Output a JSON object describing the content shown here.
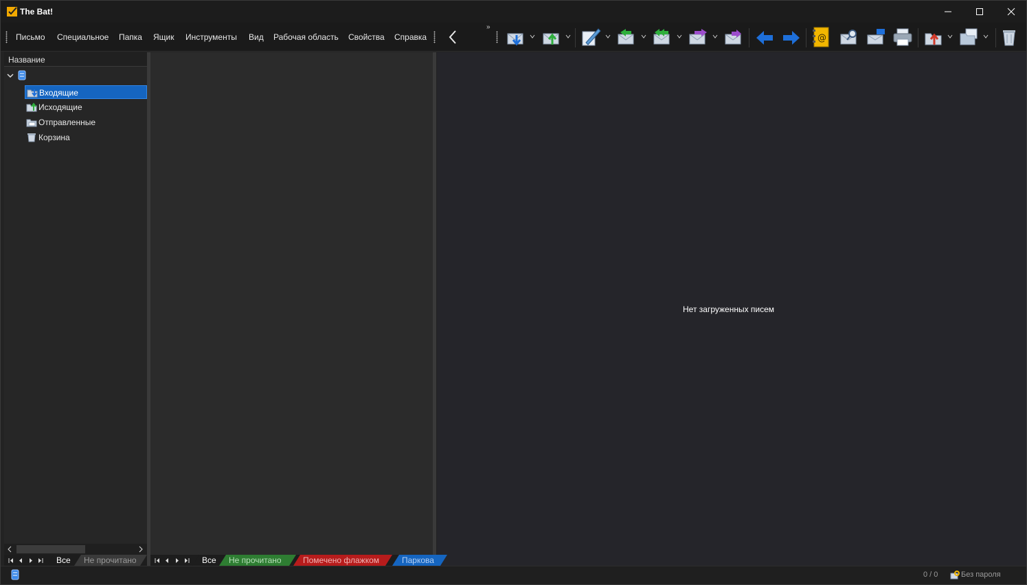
{
  "window": {
    "title": "The Bat!",
    "controls": [
      "minimize-icon",
      "maximize-icon",
      "close-icon"
    ]
  },
  "menu": {
    "items": [
      "Письмо",
      "Специальное",
      "Папка",
      "Ящик",
      "Инструменты",
      "Вид",
      "Рабочая область",
      "Свойства",
      "Справка"
    ]
  },
  "toolbar": {
    "buttons": [
      "get-mail-icon",
      "send-mail-icon",
      "new-message-icon",
      "reply-icon",
      "reply-all-icon",
      "forward-icon",
      "redirect-icon",
      "previous-icon",
      "next-icon",
      "address-book-icon",
      "find-icon",
      "mailbox-icon",
      "print-icon",
      "move-to-folder-icon",
      "copy-to-folder-icon",
      "delete-icon"
    ]
  },
  "folders": {
    "column_header": "Название",
    "account_name": "",
    "items": [
      {
        "label": "Входящие",
        "icon": "inbox-icon",
        "selected": true
      },
      {
        "label": "Исходящие",
        "icon": "outbox-icon",
        "selected": false
      },
      {
        "label": "Отправленные",
        "icon": "sent-icon",
        "selected": false
      },
      {
        "label": "Корзина",
        "icon": "trash-icon",
        "selected": false
      }
    ]
  },
  "folder_tabs": [
    "Все",
    "Не прочитано"
  ],
  "message_tabs": [
    "Все",
    "Не прочитано",
    "Помечено флажком",
    "Паркова"
  ],
  "viewer": {
    "empty_text": "Нет загруженных писем"
  },
  "status": {
    "count": "0 / 0",
    "password": "Без пароля"
  },
  "colors": {
    "accent": "#1565c0",
    "tab_unread": "#2e7d32",
    "tab_flagged": "#b71c1c",
    "tab_parked": "#1565c0"
  }
}
